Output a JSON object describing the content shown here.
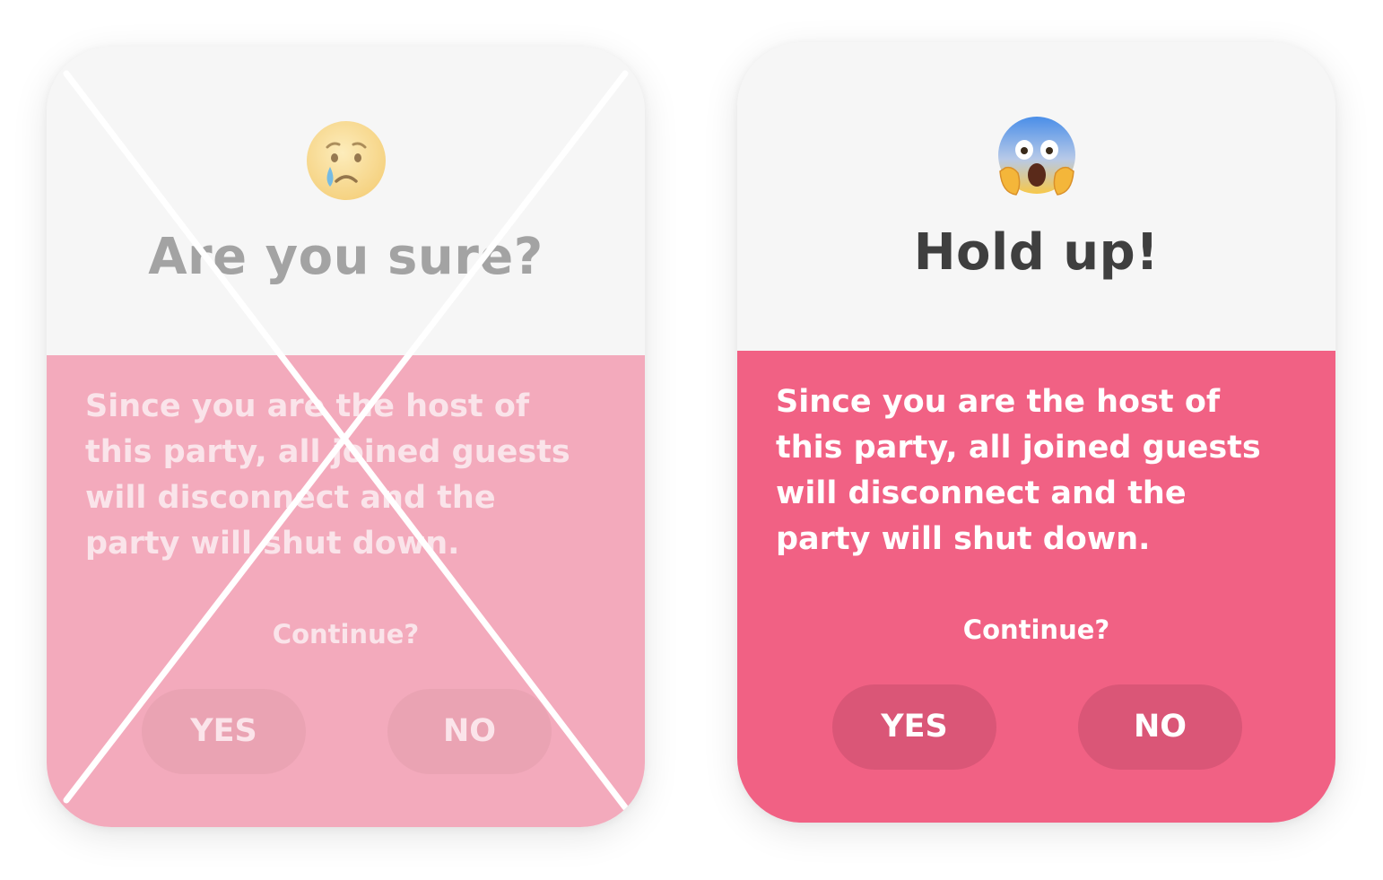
{
  "cards": [
    {
      "variant": "rejected",
      "emoji": "crying-face",
      "title": "Are you sure?",
      "message": "Since you are the host of this party, all joined guests will disconnect and the party will shut down.",
      "prompt": "Continue?",
      "yes_label": "YES",
      "no_label": "NO",
      "accent_color": "#f3aabc",
      "crossed_out": true
    },
    {
      "variant": "approved",
      "emoji": "face-screaming-in-fear",
      "title": "Hold up!",
      "message": "Since you are the host of this party, all joined guests will disconnect and the party will shut down.",
      "prompt": "Continue?",
      "yes_label": "YES",
      "no_label": "NO",
      "accent_color": "#f16184",
      "crossed_out": false
    }
  ]
}
